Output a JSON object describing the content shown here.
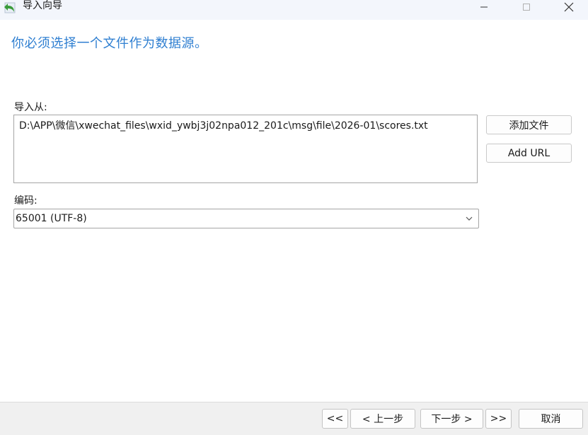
{
  "window": {
    "title": "导入向导",
    "icon": "back-arrow-icon"
  },
  "instruction": "你必须选择一个文件作为数据源。",
  "import_from": {
    "label": "导入从:",
    "path": "D:\\APP\\微信\\xwechat_files\\wxid_ywbj3j02npa012_201c\\msg\\file\\2026-01\\scores.txt",
    "add_file_label": "添加文件",
    "add_url_label": "Add URL"
  },
  "encoding": {
    "label": "编码:",
    "selected": "65001 (UTF-8)"
  },
  "footer": {
    "first_label": "<<",
    "prev_label": "< 上一步",
    "next_label": "下一步 >",
    "last_label": ">>",
    "cancel_label": "取消"
  },
  "colors": {
    "instruction": "#2f7fd1",
    "titlebar": "#f3f6fc",
    "footer": "#f0f0f0",
    "icon_green": "#3a9b3a"
  }
}
